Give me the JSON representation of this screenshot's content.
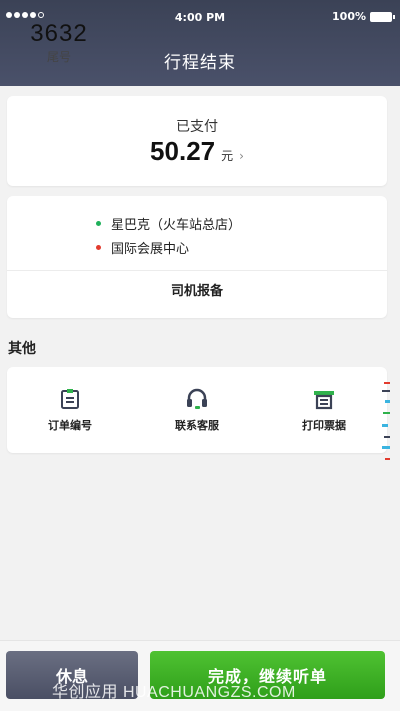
{
  "status_bar": {
    "time": "4:00 PM",
    "battery": "100%"
  },
  "header": {
    "title": "行程结束"
  },
  "payment": {
    "status": "已支付",
    "amount": "50.27",
    "unit": "元",
    "chevron": "›"
  },
  "trip": {
    "tail_number": "3632",
    "tail_label": "尾号",
    "origin": "星巴克（火车站总店）",
    "destination": "国际会展中心",
    "report_label": "司机报备"
  },
  "others": {
    "section_label": "其他",
    "tools": [
      {
        "label": "订单编号",
        "icon": "order-number-icon"
      },
      {
        "label": "联系客服",
        "icon": "headset-icon"
      },
      {
        "label": "打印票据",
        "icon": "printer-icon"
      }
    ]
  },
  "actions": {
    "rest_label": "休息",
    "done_label": "完成，继续听单"
  },
  "watermark": "华创应用 HUACHUANGZS.COM",
  "colors": {
    "header_bg": "#3b4256",
    "accent_green": "#2fb24c",
    "origin_dot": "#1fb05a",
    "destination_dot": "#e23b2e",
    "rest_button": "#5a5f73"
  }
}
